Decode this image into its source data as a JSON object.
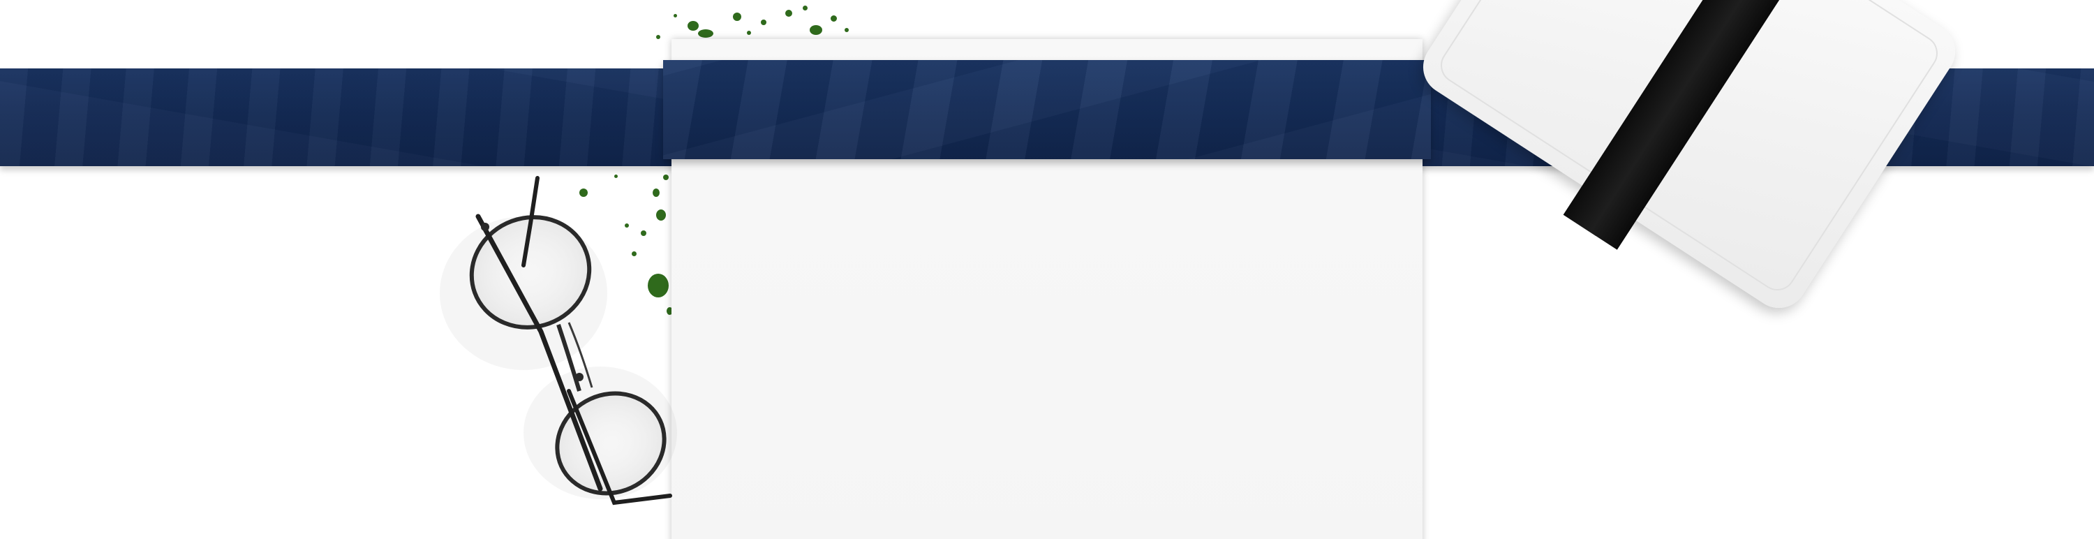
{
  "scene": {
    "description_type": "flat-lay",
    "colors": {
      "background": "#ffffff",
      "ribbon": "#142b57",
      "paper": "#f6f6f6",
      "card": "#f3f3f3",
      "strap": "#111111",
      "splatter": "#2f6a1c",
      "glasses_frame": "#2a2a2a"
    },
    "icons": [
      "eyeglasses-icon",
      "paint-splatter-icon",
      "card-with-strap-icon"
    ]
  }
}
